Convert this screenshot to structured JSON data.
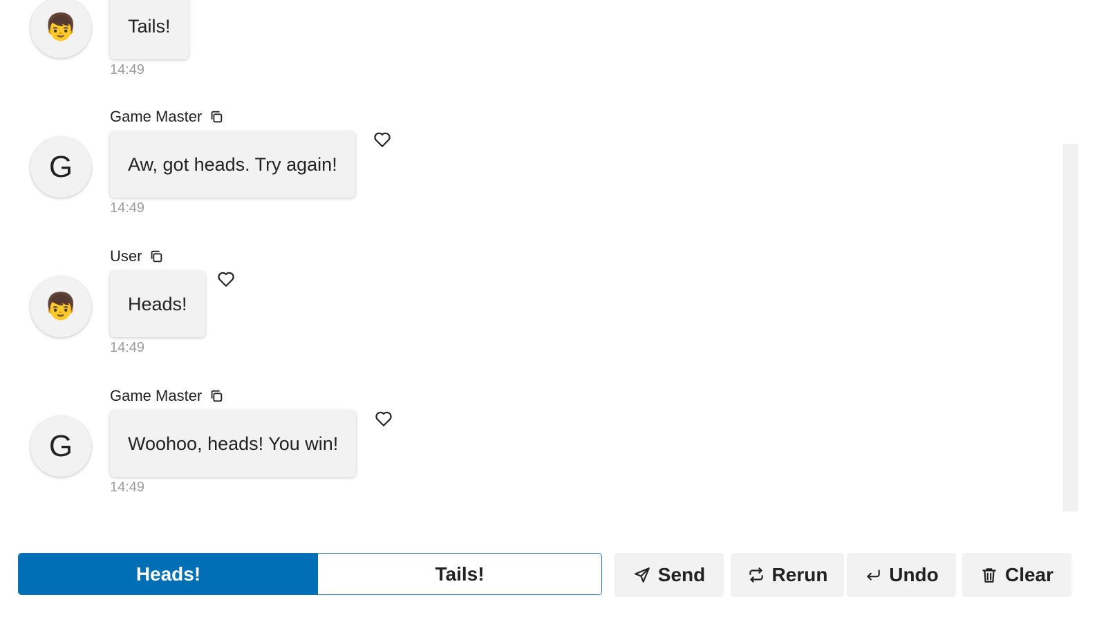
{
  "messages": [
    {
      "sender": "",
      "avatar": "👦",
      "text": "Tails!",
      "time": "14:49"
    },
    {
      "sender": "Game Master",
      "avatar": "G",
      "text": "Aw, got heads. Try again!",
      "time": "14:49"
    },
    {
      "sender": "User",
      "avatar": "👦",
      "text": "Heads!",
      "time": "14:49"
    },
    {
      "sender": "Game Master",
      "avatar": "G",
      "text": "Woohoo, heads! You win!",
      "time": "14:49"
    }
  ],
  "choices": {
    "options": [
      "Heads!",
      "Tails!"
    ],
    "selected": "Heads!"
  },
  "actions": {
    "send_label": "Send",
    "rerun_label": "Rerun",
    "undo_label": "Undo",
    "clear_label": "Clear"
  },
  "colors": {
    "accent": "#006fb6",
    "bubble": "#f2f2f2",
    "timestamp": "#9e9e9e"
  },
  "icons": {
    "copy": "copy-icon",
    "like": "heart-icon",
    "send": "send-icon",
    "rerun": "rerun-icon",
    "undo": "undo-icon",
    "clear": "trash-icon"
  }
}
